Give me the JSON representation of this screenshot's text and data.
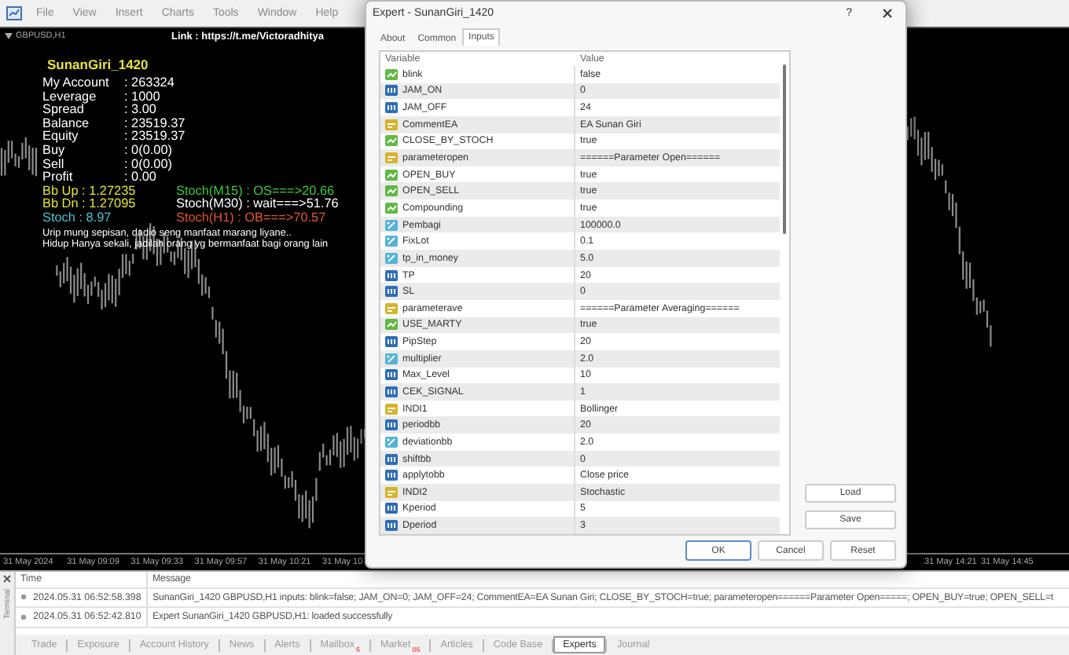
{
  "menu": {
    "items": [
      "File",
      "View",
      "Insert",
      "Charts",
      "Tools",
      "Window",
      "Help"
    ]
  },
  "chart": {
    "symbol": "GBPUSD,H1",
    "link": "Link : https://t.me/Victoradhitya",
    "panel": {
      "title": "SunanGiri_1420",
      "stats": [
        {
          "label": "My Account",
          "value": ": 263324"
        },
        {
          "label": "Leverage",
          "value": ": 1000"
        },
        {
          "label": "Spread",
          "value": ": 3.00"
        },
        {
          "label": "Balance",
          "value": ": 23519.37"
        },
        {
          "label": "Equity",
          "value": ": 23519.37"
        },
        {
          "label": "Buy",
          "value": ": 0(0.00)"
        },
        {
          "label": "Sell",
          "value": ": 0(0.00)"
        },
        {
          "label": "Profit",
          "value": ": 0.00"
        }
      ],
      "indicators": [
        {
          "text": "Bb Up : 1.27235",
          "color": "#e6e23c"
        },
        {
          "text": "Stoch(M15) : OS===>20.66",
          "color": "#3cc83c"
        },
        {
          "text": "Bb Dn : 1.27095",
          "color": "#e6e23c"
        },
        {
          "text": "Stoch(M30) : wait===>51.76",
          "color": "#ffffff"
        },
        {
          "text": "Stoch : 8.97",
          "color": "#46c0d0"
        },
        {
          "text": "Stoch(H1) : OB===>70.57",
          "color": "#e0552a"
        }
      ],
      "notes": [
        "Urip mung sepisan, dadio seng manfaat marang liyane..",
        "Hidup Hanya sekali, jadilah orang yg bermanfaat bagi orang lain"
      ]
    },
    "time_axis_left": [
      "31 May 2024",
      "31 May 09:09",
      "31 May 09:33",
      "31 May 09:57",
      "31 May 10:21",
      "31 May 10"
    ],
    "time_axis_right": [
      "31 May 14:21",
      "31 May 14:45"
    ]
  },
  "dialog": {
    "title": "Expert - SunanGiri_1420",
    "help": "?",
    "tabs": [
      {
        "label": "About",
        "selected": false
      },
      {
        "label": "Common",
        "selected": false
      },
      {
        "label": "Inputs",
        "selected": true
      }
    ],
    "columns": [
      "Variable",
      "Value"
    ],
    "inputs": [
      {
        "kind": "bool",
        "name": "blink",
        "value": "false"
      },
      {
        "kind": "int",
        "name": "JAM_ON",
        "value": "0"
      },
      {
        "kind": "int",
        "name": "JAM_OFF",
        "value": "24"
      },
      {
        "kind": "string",
        "name": "CommentEA",
        "value": "EA Sunan Giri"
      },
      {
        "kind": "bool",
        "name": "CLOSE_BY_STOCH",
        "value": "true"
      },
      {
        "kind": "string",
        "name": "parameteropen",
        "value": "======Parameter Open======"
      },
      {
        "kind": "bool",
        "name": "OPEN_BUY",
        "value": "true"
      },
      {
        "kind": "bool",
        "name": "OPEN_SELL",
        "value": "true"
      },
      {
        "kind": "bool",
        "name": "Compounding",
        "value": "true"
      },
      {
        "kind": "double",
        "name": "Pembagi",
        "value": "100000.0"
      },
      {
        "kind": "double",
        "name": "FixLot",
        "value": "0.1"
      },
      {
        "kind": "double",
        "name": "tp_in_money",
        "value": "5.0"
      },
      {
        "kind": "int",
        "name": "TP",
        "value": "20"
      },
      {
        "kind": "int",
        "name": "SL",
        "value": "0"
      },
      {
        "kind": "string",
        "name": "parameterave",
        "value": "======Parameter Averaging======"
      },
      {
        "kind": "bool",
        "name": "USE_MARTY",
        "value": "true"
      },
      {
        "kind": "int",
        "name": "PipStep",
        "value": "20"
      },
      {
        "kind": "double",
        "name": "multiplier",
        "value": "2.0"
      },
      {
        "kind": "int",
        "name": "Max_Level",
        "value": "10"
      },
      {
        "kind": "int",
        "name": "CEK_SIGNAL",
        "value": "1"
      },
      {
        "kind": "string",
        "name": "INDI1",
        "value": "Bollinger"
      },
      {
        "kind": "int",
        "name": "periodbb",
        "value": "20"
      },
      {
        "kind": "double",
        "name": "deviationbb",
        "value": "2.0"
      },
      {
        "kind": "int",
        "name": "shiftbb",
        "value": "0"
      },
      {
        "kind": "int",
        "name": "applytobb",
        "value": "Close price"
      },
      {
        "kind": "string",
        "name": "INDI2",
        "value": "Stochastic"
      },
      {
        "kind": "int",
        "name": "Kperiod",
        "value": "5"
      },
      {
        "kind": "int",
        "name": "Dperiod",
        "value": "3"
      }
    ],
    "side_buttons": [
      "Load",
      "Save"
    ],
    "buttons": [
      "OK",
      "Cancel",
      "Reset"
    ]
  },
  "terminal": {
    "label": "Terminal",
    "columns": [
      "Time",
      "Message"
    ],
    "rows": [
      {
        "time": "2024.05.31 06:52:58.398",
        "message": "SunanGiri_1420 GBPUSD,H1 inputs: blink=false; JAM_ON=0; JAM_OFF=24; CommentEA=EA Sunan Giri; CLOSE_BY_STOCH=true; parameteropen======Parameter Open=====; OPEN_BUY=true; OPEN_SELL=t"
      },
      {
        "time": "2024.05.31 06:52:42.810",
        "message": "Expert SunanGiri_1420 GBPUSD,H1: loaded successfully"
      }
    ],
    "tabs": [
      {
        "label": "Trade",
        "selected": false
      },
      {
        "label": "Exposure",
        "selected": false
      },
      {
        "label": "Account History",
        "selected": false
      },
      {
        "label": "News",
        "selected": false
      },
      {
        "label": "Alerts",
        "selected": false
      },
      {
        "label": "Mailbox",
        "badge": "6",
        "selected": false
      },
      {
        "label": "Market",
        "badge": "86",
        "selected": false
      },
      {
        "label": "Articles",
        "selected": false
      },
      {
        "label": "Code Base",
        "selected": false
      },
      {
        "label": "Experts",
        "selected": true
      },
      {
        "label": "Journal",
        "selected": false
      }
    ]
  }
}
